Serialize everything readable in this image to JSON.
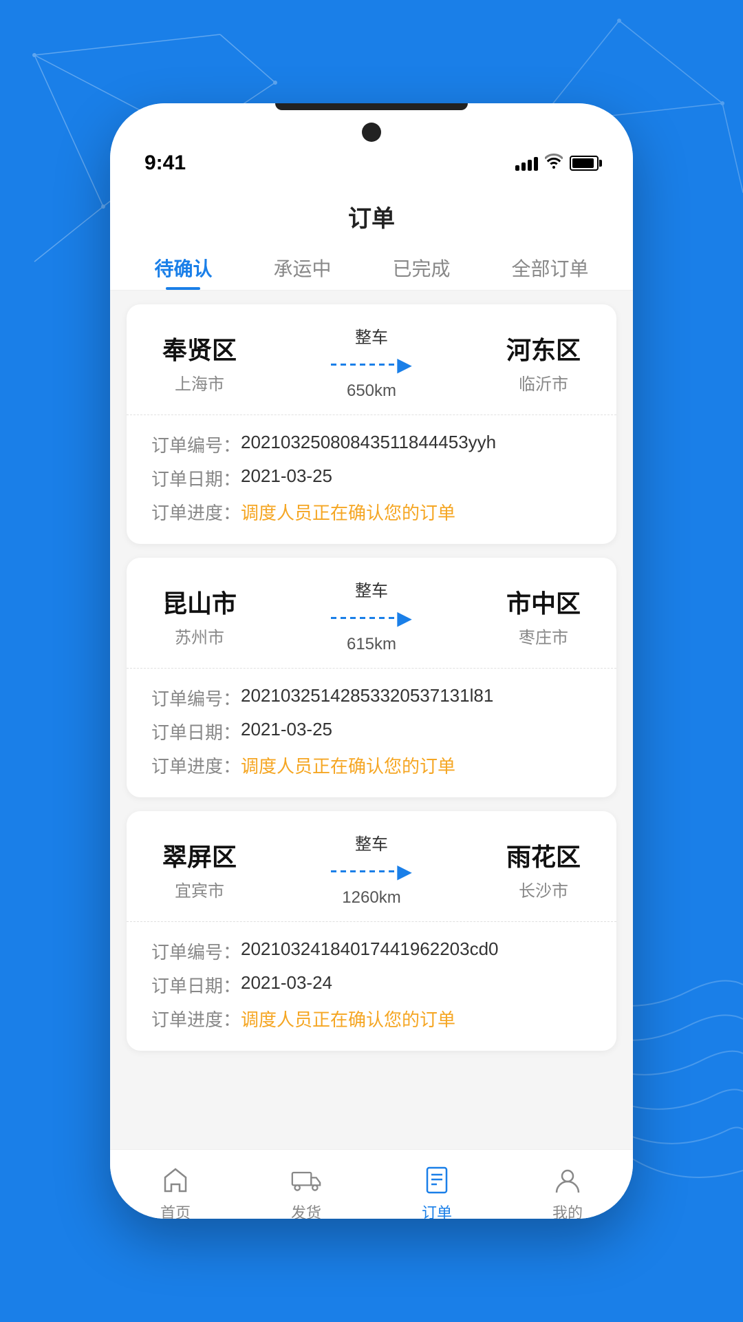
{
  "background": {
    "color": "#1a7fe8"
  },
  "status_bar": {
    "time": "9:41",
    "signal_bars": [
      8,
      12,
      16,
      20
    ],
    "battery_level": 90
  },
  "page": {
    "title": "订单"
  },
  "tabs": [
    {
      "id": "pending",
      "label": "待确认",
      "active": true
    },
    {
      "id": "in_transit",
      "label": "承运中",
      "active": false
    },
    {
      "id": "completed",
      "label": "已完成",
      "active": false
    },
    {
      "id": "all",
      "label": "全部订单",
      "active": false
    }
  ],
  "orders": [
    {
      "from_name": "奉贤区",
      "from_city": "上海市",
      "to_name": "河东区",
      "to_city": "临沂市",
      "type": "整车",
      "distance": "650km",
      "order_number_label": "订单编号：",
      "order_number": "20210325080843511844453yyh",
      "order_date_label": "订单日期：",
      "order_date": "2021-03-25",
      "order_progress_label": "订单进度：",
      "order_progress": "调度人员正在确认您的订单"
    },
    {
      "from_name": "昆山市",
      "from_city": "苏州市",
      "to_name": "市中区",
      "to_city": "枣庄市",
      "type": "整车",
      "distance": "615km",
      "order_number_label": "订单编号：",
      "order_number": "20210325142853320537131l81",
      "order_date_label": "订单日期：",
      "order_date": "2021-03-25",
      "order_progress_label": "订单进度：",
      "order_progress": "调度人员正在确认您的订单"
    },
    {
      "from_name": "翠屏区",
      "from_city": "宜宾市",
      "to_name": "雨花区",
      "to_city": "长沙市",
      "type": "整车",
      "distance": "1260km",
      "order_number_label": "订单编号：",
      "order_number": "20210324184017441962203cd0",
      "order_date_label": "订单日期：",
      "order_date": "2021-03-24",
      "order_progress_label": "订单进度：",
      "order_progress": "调度人员正在确认您的订单"
    }
  ],
  "bottom_nav": [
    {
      "id": "home",
      "label": "首页",
      "active": false,
      "icon": "home"
    },
    {
      "id": "shipping",
      "label": "发货",
      "active": false,
      "icon": "truck"
    },
    {
      "id": "orders",
      "label": "订单",
      "active": true,
      "icon": "orders"
    },
    {
      "id": "mine",
      "label": "我的",
      "active": false,
      "icon": "user"
    }
  ]
}
